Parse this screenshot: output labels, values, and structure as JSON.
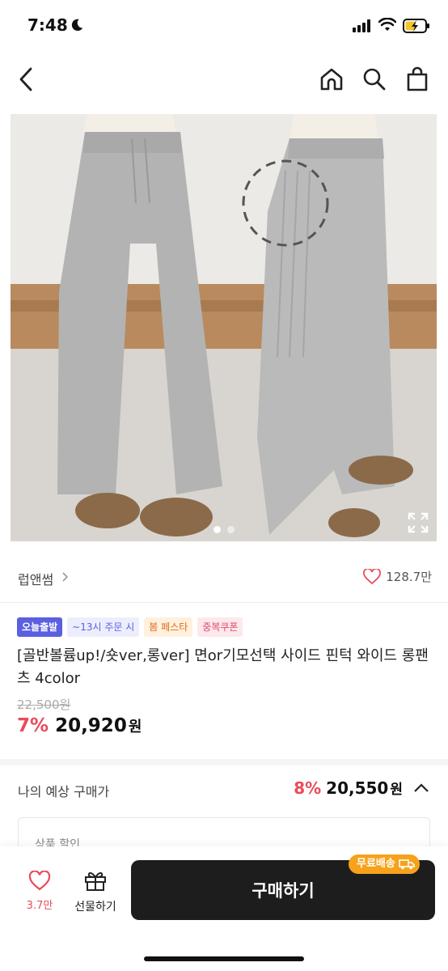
{
  "status": {
    "time": "7:48"
  },
  "nav": {
    "back": "back",
    "icons": [
      "home-icon",
      "search-icon",
      "shopping-bag-icon"
    ]
  },
  "gallery": {
    "current_page": 1,
    "total_pages": 2
  },
  "seller": {
    "name": "럽앤썸",
    "likes": "128.7만"
  },
  "badges": [
    "오늘출발",
    "~13시 주문 시",
    "봄 페스타",
    "중복쿠폰"
  ],
  "product": {
    "title": "[골반볼륨up!/숏ver,롱ver] 면or기모선택 사이드 핀턱 와이드 롱팬츠 4color",
    "original_price": "22,500원",
    "discount_pct": "7%",
    "sale_price": "20,920",
    "won": "원"
  },
  "expected": {
    "label": "나의 예상 구매가",
    "pct": "8%",
    "price": "20,550",
    "won": "원"
  },
  "discount_box": {
    "label": "상품 할인"
  },
  "bottom": {
    "like_count": "3.7만",
    "gift_label": "선물하기",
    "buy_label": "구매하기",
    "free_shipping": "무료배송"
  },
  "colors": {
    "accent": "#e94b5c",
    "buy": "#1d1d1d",
    "badge_primary": "#5b5fe0",
    "free_ship": "#f6a21a"
  }
}
